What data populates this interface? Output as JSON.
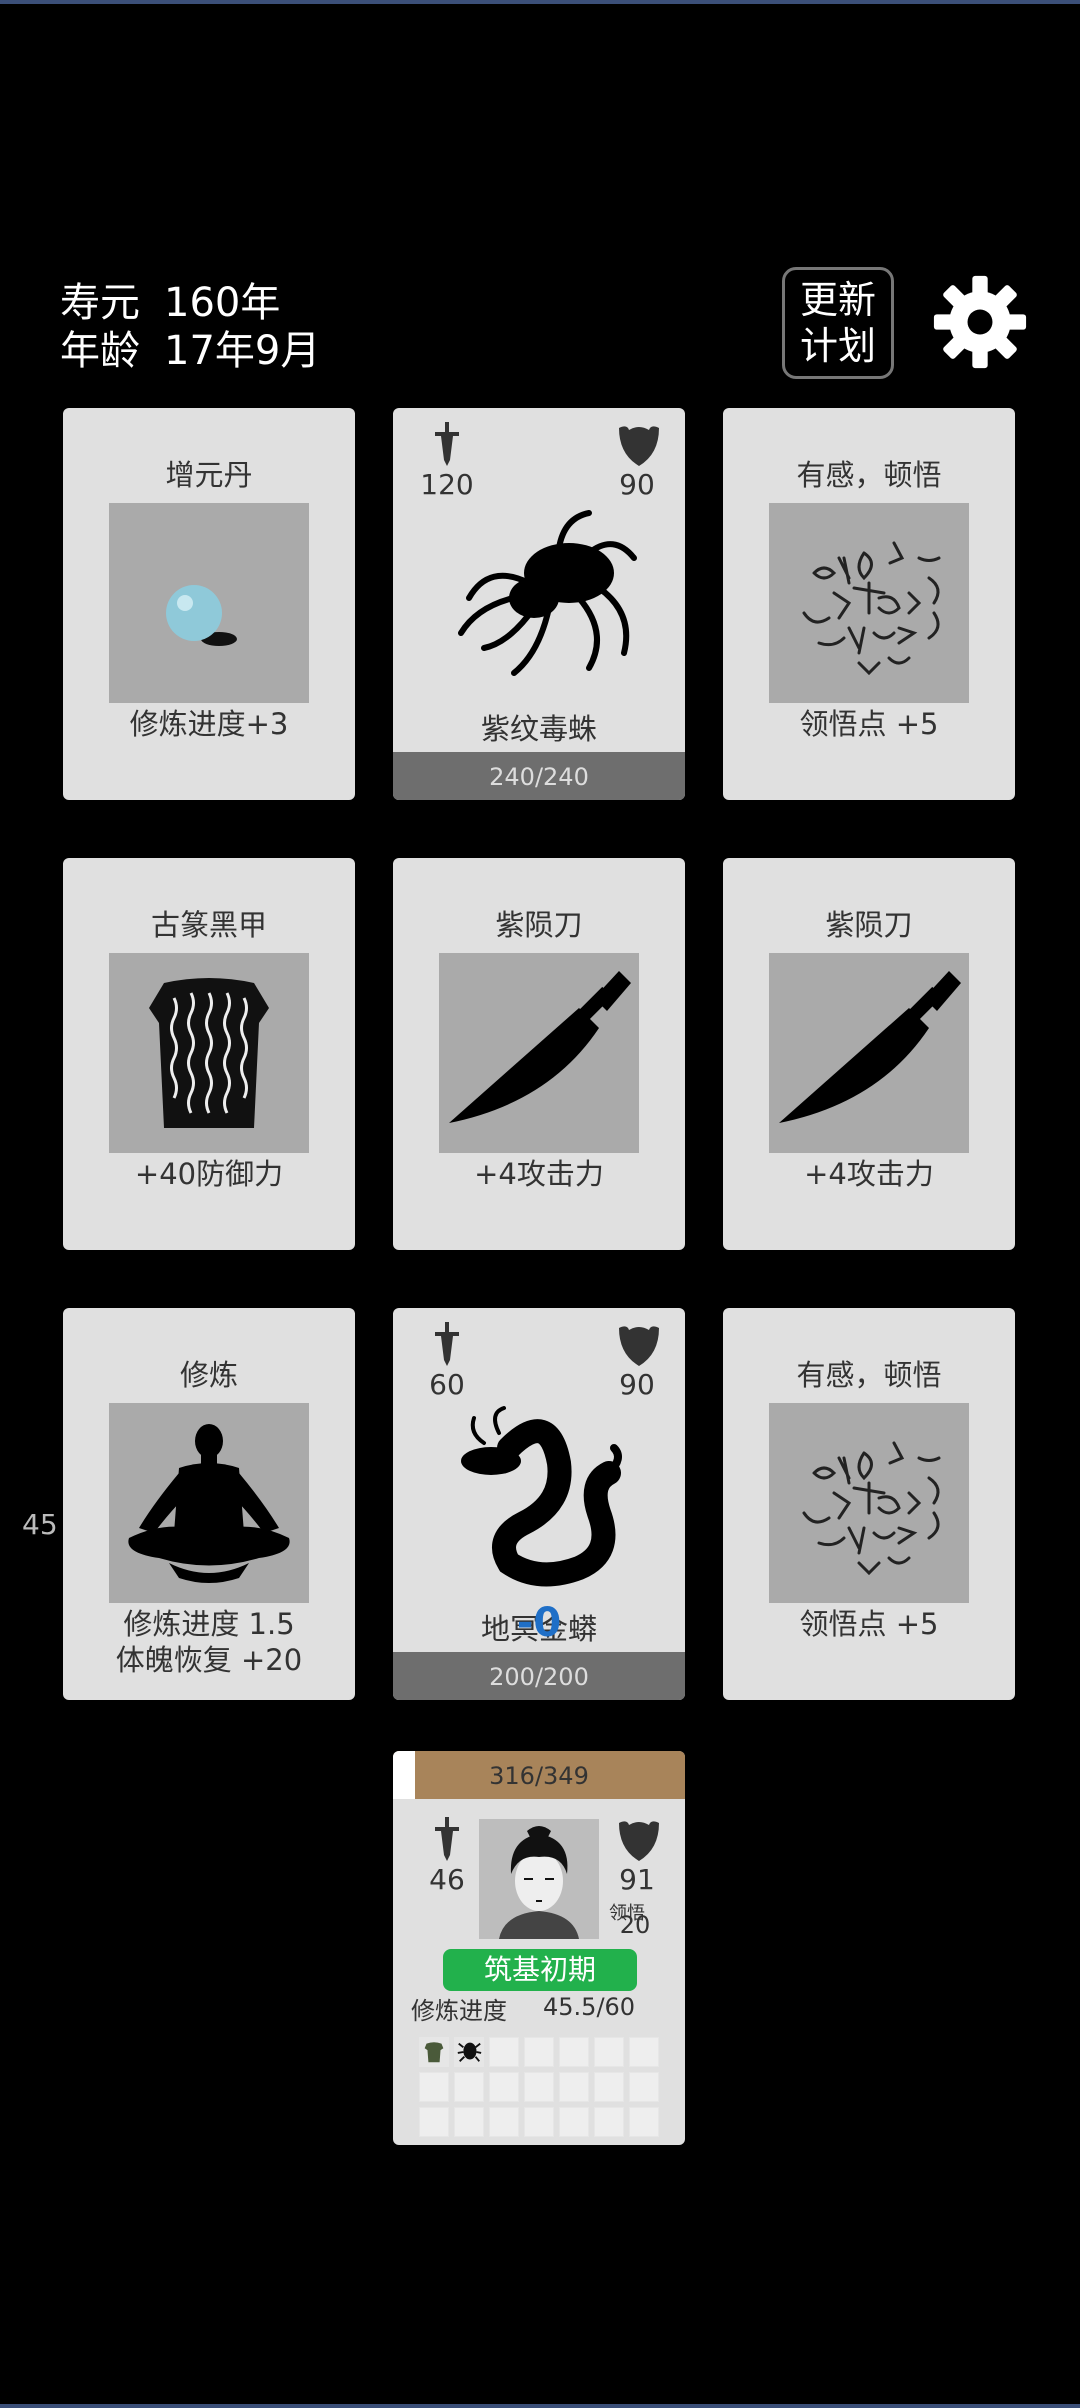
{
  "status": {
    "lifespan_label": "寿元",
    "lifespan_value": "160年",
    "age_label": "年龄",
    "age_value": "17年9月"
  },
  "toolbar": {
    "update_line1": "更新",
    "update_line2": "计划",
    "settings_icon": "gear-icon"
  },
  "cards": {
    "c1": {
      "title": "增元丹",
      "effect": "修炼进度+3",
      "icon": "pill-icon"
    },
    "c2": {
      "name": "紫纹毒蛛",
      "atk": "120",
      "def": "90",
      "hp": "240/240",
      "icon": "spider-icon"
    },
    "c3": {
      "title": "有感，顿悟",
      "effect": "领悟点  +5",
      "icon": "calligraphy-icon"
    },
    "c4": {
      "title": "古篆黑甲",
      "effect": "+40防御力",
      "icon": "armor-icon"
    },
    "c5": {
      "title": "紫陨刀",
      "effect": "+4攻击力",
      "icon": "blade-icon"
    },
    "c6": {
      "title": "紫陨刀",
      "effect": "+4攻击力",
      "icon": "blade-icon"
    },
    "c7": {
      "title": "修炼",
      "effect1": "修炼进度  1.5",
      "effect2": "体魄恢复  +20",
      "icon": "meditation-icon"
    },
    "c8": {
      "name": "地冥金蟒",
      "atk": "60",
      "def": "90",
      "hp": "200/200",
      "float": "-0",
      "icon": "serpent-icon"
    },
    "c9": {
      "title": "有感，顿悟",
      "effect": "领悟点  +5",
      "icon": "calligraphy-icon"
    }
  },
  "side_number": "45",
  "player": {
    "hp": "316/349",
    "hp_fraction": 0.925,
    "atk": "46",
    "def": "91",
    "insight_label": "领悟",
    "insight": "20",
    "realm": "筑基初期",
    "progress_label": "修炼进度",
    "progress_value": "45.5/60",
    "inventory_filled": [
      "armor-icon",
      "spider-icon"
    ],
    "colors": {
      "realm": "#22b14c",
      "hp": "#a8845a"
    }
  }
}
